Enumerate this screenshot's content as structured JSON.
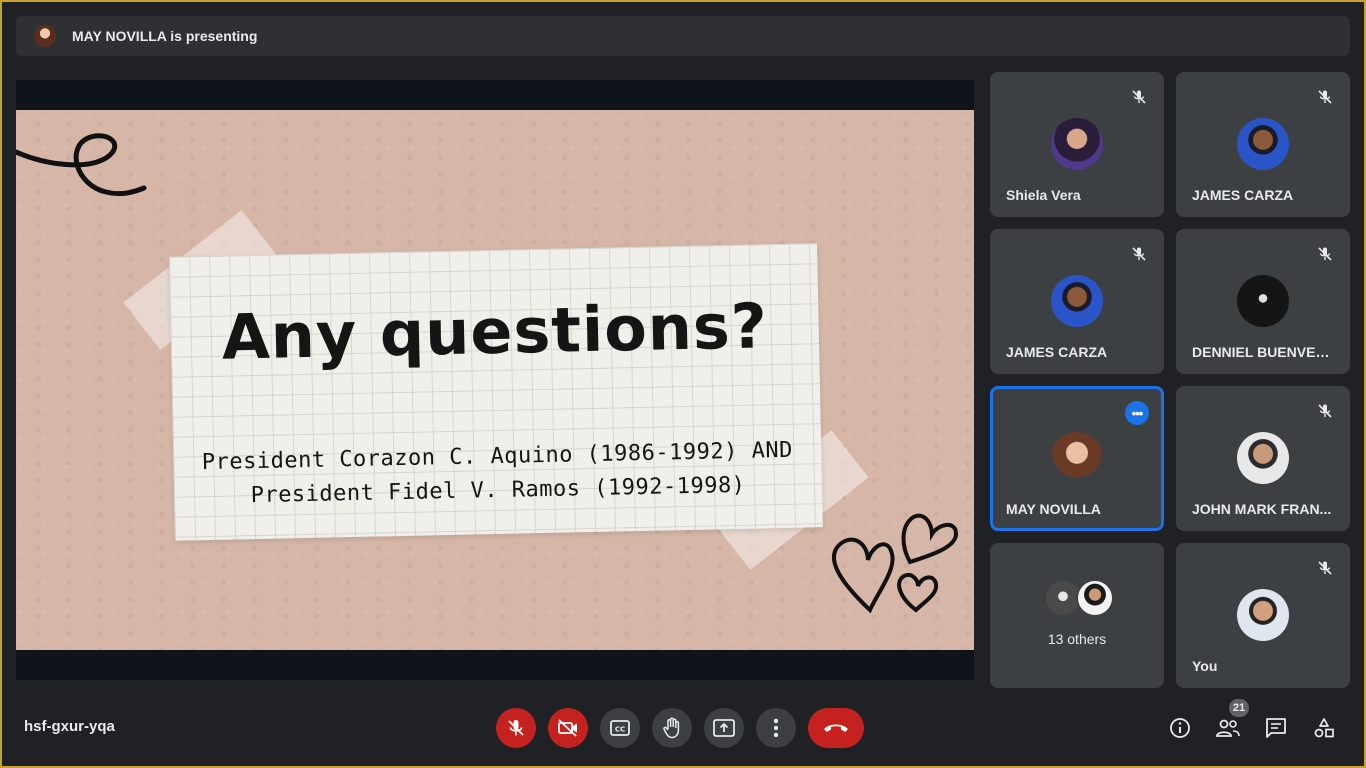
{
  "banner": {
    "text": "MAY NOVILLA is presenting"
  },
  "slide": {
    "title": "Any questions?",
    "subtitle_line1": "President Corazon C. Aquino (1986-1992) AND",
    "subtitle_line2": "President Fidel V. Ramos (1992-1998)"
  },
  "participants": [
    {
      "name": "Shiela Vera",
      "muted": true
    },
    {
      "name": "JAMES CARZA",
      "muted": true
    },
    {
      "name": "JAMES CARZA",
      "muted": true
    },
    {
      "name": "DENNIEL BUENVENI...",
      "muted": true
    },
    {
      "name": "MAY NOVILLA",
      "muted": false,
      "active": true
    },
    {
      "name": "JOHN MARK FRAN...",
      "muted": true
    },
    {
      "name": "13 others"
    },
    {
      "name": "You",
      "muted": true
    }
  ],
  "meeting": {
    "code": "hsf-gxur-yqa",
    "participant_count": "21"
  },
  "controls": [
    "mic-off-icon",
    "camera-off-icon",
    "captions-icon",
    "raise-hand-icon",
    "present-icon",
    "more-options-icon",
    "end-call-icon"
  ],
  "right_controls": [
    "info-icon",
    "people-icon",
    "chat-icon",
    "activities-icon"
  ],
  "colors": {
    "accent": "#1a73e8",
    "danger": "#c5221f",
    "tile": "#3c4043",
    "background": "#202124"
  }
}
